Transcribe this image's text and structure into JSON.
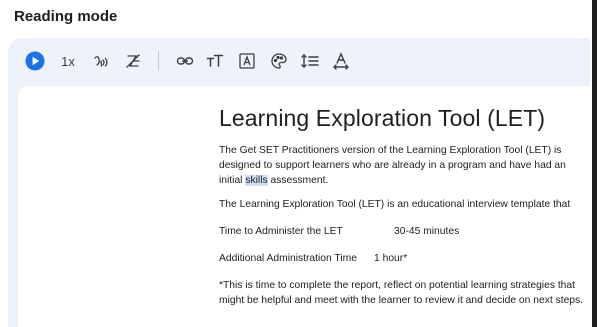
{
  "panel": {
    "title": "Reading mode"
  },
  "toolbar": {
    "play_icon": "play-icon",
    "speed_label": "1x",
    "voice_icon": "voice-icon",
    "highlight_icon": "highlight-off-icon",
    "link_icon": "link-icon",
    "font_size_icon": "font-size-icon",
    "font_icon": "font-icon",
    "theme_icon": "palette-icon",
    "line_spacing_icon": "line-spacing-icon",
    "letter_spacing_icon": "letter-spacing-icon",
    "accent_color": "#1a73e8"
  },
  "article": {
    "title": "Learning Exploration Tool (LET)",
    "p1_before": "The Get SET Practitioners version of the Learning Exploration Tool (LET) is designed to support learners who are already in a program and have had an initial ",
    "p1_highlight": "skills",
    "p1_after": " assessment.",
    "p2": "The Learning Exploration Tool (LET) is an educational interview template that",
    "row1_label": "Time to Administer the LET",
    "row1_value": "30-45 minutes",
    "row2_label": "Additional Administration Time",
    "row2_value": "1 hour*",
    "p3": "*This is time to complete the report, reflect on potential learning strategies that might be helpful and meet with the learner to review it and decide on next steps."
  }
}
